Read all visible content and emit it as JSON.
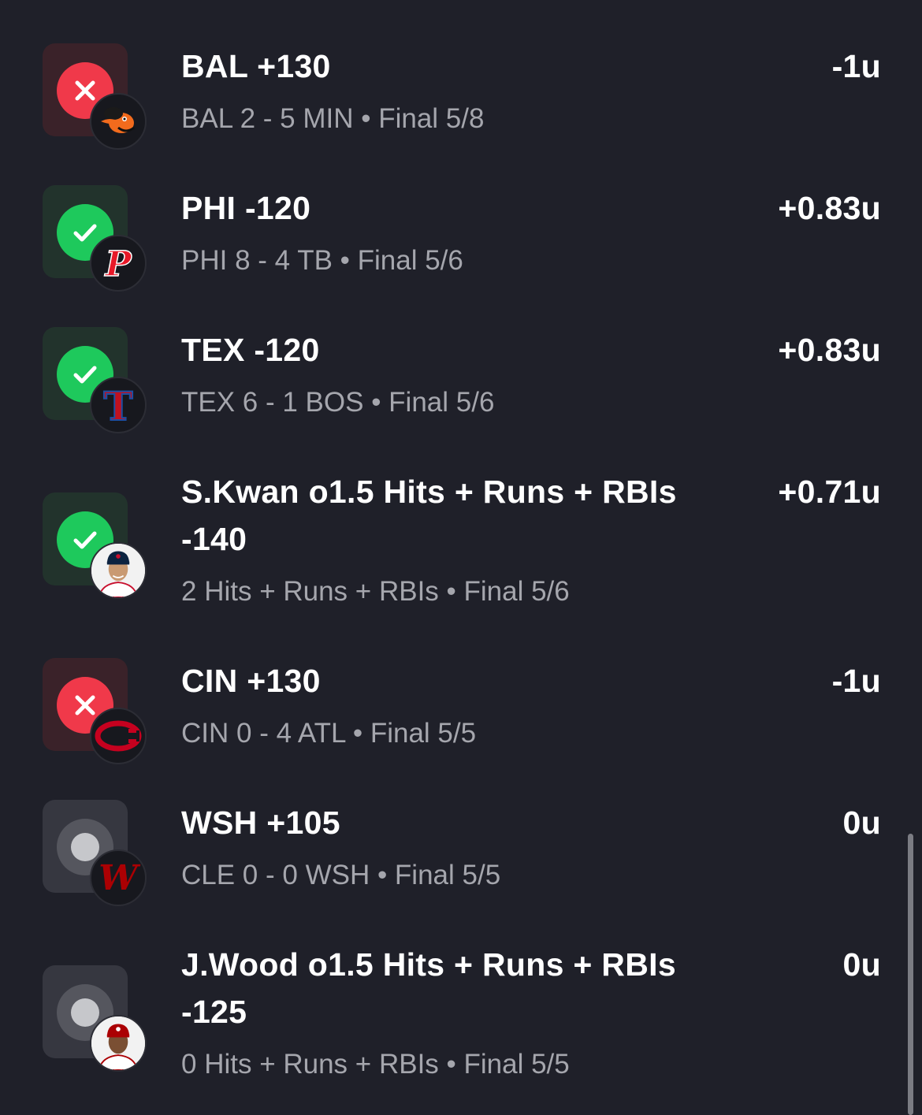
{
  "colors": {
    "background": "#1f2029",
    "loss": "#f0394a",
    "win": "#1ec95c",
    "push": "#55565e",
    "subtext": "#a5a6ad"
  },
  "bets": [
    {
      "status": "loss",
      "status_icon": "x-icon",
      "avatar_icon": "orioles-logo-icon",
      "title": "BAL +130",
      "title_line2": "",
      "result": "-1u",
      "detail": "BAL 2 - 5 MIN • Final 5/8"
    },
    {
      "status": "win",
      "status_icon": "checkmark-icon",
      "avatar_icon": "phillies-logo-icon",
      "title": "PHI -120",
      "title_line2": "",
      "result": "+0.83u",
      "detail": "PHI 8 - 4 TB • Final 5/6"
    },
    {
      "status": "win",
      "status_icon": "checkmark-icon",
      "avatar_icon": "rangers-logo-icon",
      "title": "TEX -120",
      "title_line2": "",
      "result": "+0.83u",
      "detail": "TEX 6 - 1 BOS • Final 5/6"
    },
    {
      "status": "win",
      "status_icon": "checkmark-icon",
      "avatar_icon": "player-headshot-icon",
      "title": "S.Kwan o1.5 Hits + Runs + RBIs",
      "title_line2": "-140",
      "result": "+0.71u",
      "detail": "2 Hits + Runs + RBIs • Final 5/6"
    },
    {
      "status": "loss",
      "status_icon": "x-icon",
      "avatar_icon": "reds-logo-icon",
      "title": "CIN +130",
      "title_line2": "",
      "result": "-1u",
      "detail": "CIN 0 - 4 ATL • Final 5/5"
    },
    {
      "status": "push",
      "status_icon": "push-dot-icon",
      "avatar_icon": "nationals-logo-icon",
      "title": "WSH +105",
      "title_line2": "",
      "result": "0u",
      "detail": "CLE 0 - 0 WSH • Final 5/5"
    },
    {
      "status": "push",
      "status_icon": "push-dot-icon",
      "avatar_icon": "player-headshot-icon",
      "title": "J.Wood o1.5 Hits + Runs + RBIs",
      "title_line2": "-125",
      "result": "0u",
      "detail": "0 Hits + Runs + RBIs • Final 5/5"
    }
  ]
}
